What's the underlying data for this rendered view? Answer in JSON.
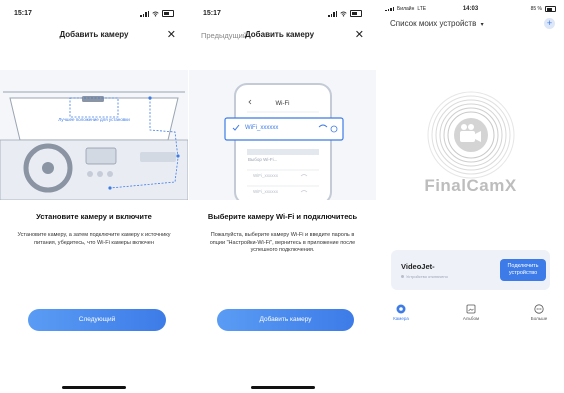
{
  "screen1": {
    "status_time": "15:17",
    "header_title": "Добавить камеру",
    "close": "✕",
    "best_position_label": "Лучшее положение для установки",
    "step_title": "Установите камеру и включите",
    "step_desc": "Установите камеру, а затем подключите камеру к источнику питания, убедитесь, что Wi-Fi камеры включен",
    "next_button": "Следующий"
  },
  "screen2": {
    "status_time": "15:17",
    "prev_label": "Предыдущий",
    "header_title": "Добавить камеру",
    "close": "✕",
    "phone_title": "Wi-Fi",
    "selected_network": "WiFi_xxxxxx",
    "choose_label": "Выбор Wi-Fi...",
    "network_2": "WiFi_xxxxxx",
    "network_3": "WiFi_xxxxxx",
    "step_title": "Выберите камеру Wi-Fi и подключитесь",
    "step_desc": "Пожалуйста, выберите камеру Wi-Fi и введите пароль в опции \"Настройки-Wi-Fi\", вернитесь в приложение после успешного подключения.",
    "add_button": "Добавить камеру"
  },
  "screen3": {
    "carrier": "Билайн",
    "network_type": "LTE",
    "status_time": "14:03",
    "battery": "85 %",
    "devices_title": "Список моих устройств",
    "dropdown_caret": "▾",
    "add_symbol": "+",
    "brand": "FinalCamX",
    "device_name": "VideoJet-",
    "device_status": "Устройство отключено",
    "connect_button": "Подключить устройство",
    "tabs": [
      "Камера",
      "Альбом",
      "Больше"
    ]
  },
  "colors": {
    "accent": "#3d7be8",
    "accent_light": "#5a9cf4",
    "muted": "#bdbdbd"
  }
}
